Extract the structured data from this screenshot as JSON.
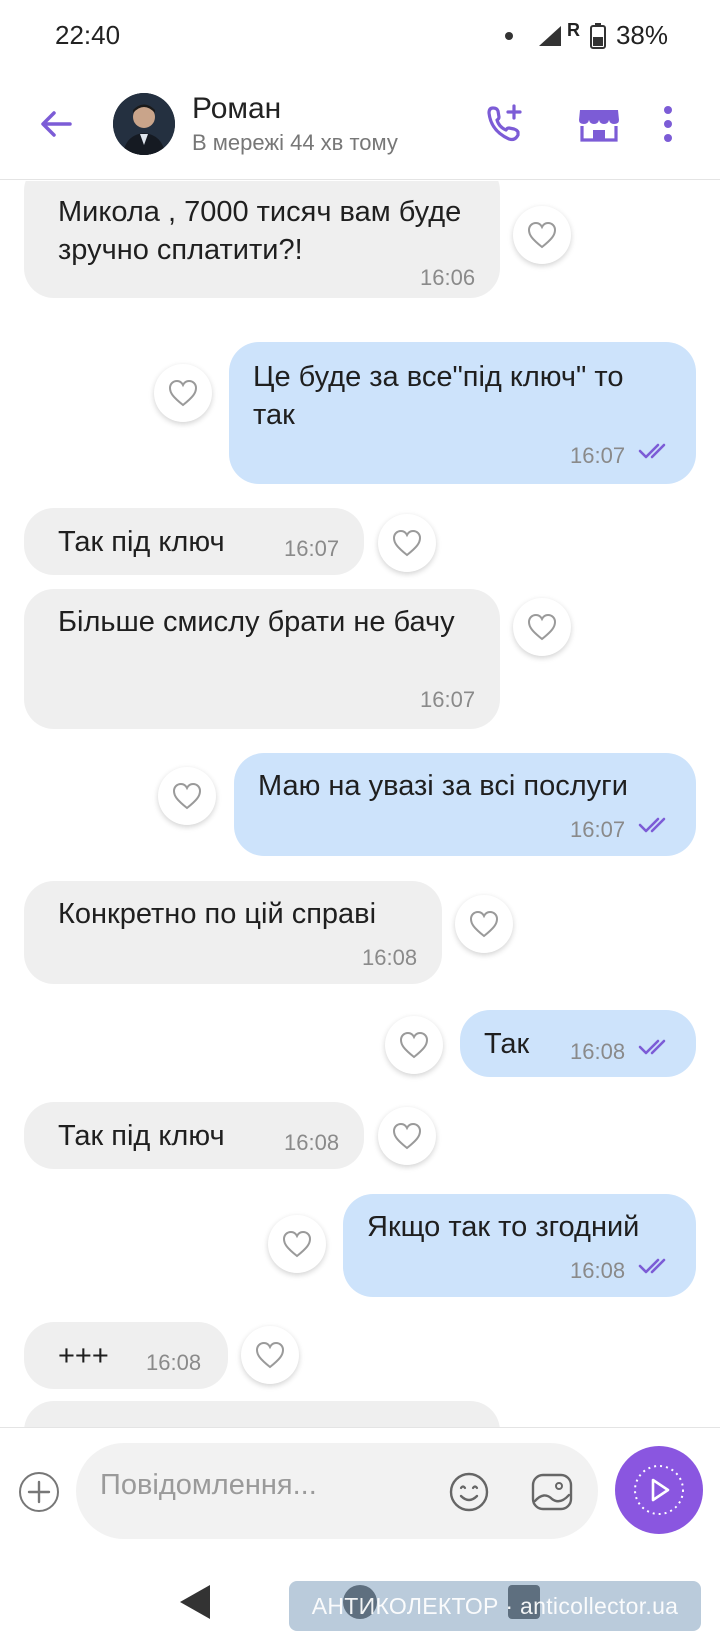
{
  "status_bar": {
    "time": "22:40",
    "roaming": "R",
    "battery": "38%"
  },
  "header": {
    "contact_name": "Роман",
    "contact_status": "В мережі 44 хв тому",
    "icons": [
      "back-arrow-icon",
      "add-call-icon",
      "store-icon",
      "more-vert-icon"
    ],
    "accent_color": "#7c5cd6"
  },
  "messages": [
    {
      "direction": "in",
      "text": "Микола , 7000 тисяч вам буде зручно сплатити?!",
      "time": "16:06"
    },
    {
      "direction": "out",
      "text": "Це буде за все\"під ключ\" то так",
      "time": "16:07"
    },
    {
      "direction": "in",
      "text": "Так під ключ",
      "time": "16:07"
    },
    {
      "direction": "in",
      "text": "Більше смислу брати не бачу",
      "time": "16:07"
    },
    {
      "direction": "out",
      "text": "Маю на увазі за всі послуги",
      "time": "16:07"
    },
    {
      "direction": "in",
      "text": "Конкретно по цій справі",
      "time": "16:08"
    },
    {
      "direction": "out",
      "text": "Так",
      "time": "16:08"
    },
    {
      "direction": "in",
      "text": "Так під ключ",
      "time": "16:08"
    },
    {
      "direction": "out",
      "text": "Якщо так то згодний",
      "time": "16:08"
    },
    {
      "direction": "in",
      "text": "+++",
      "time": "16:08"
    }
  ],
  "composer": {
    "placeholder": "Повідомлення...",
    "send_color": "#8a56e0"
  },
  "watermark": {
    "text": "АНТИКОЛЕКТОР · anticollector.ua"
  },
  "colors": {
    "incoming_bubble": "#efefef",
    "outgoing_bubble": "#cde3fb",
    "read_ticks": "#7c5cd6"
  }
}
